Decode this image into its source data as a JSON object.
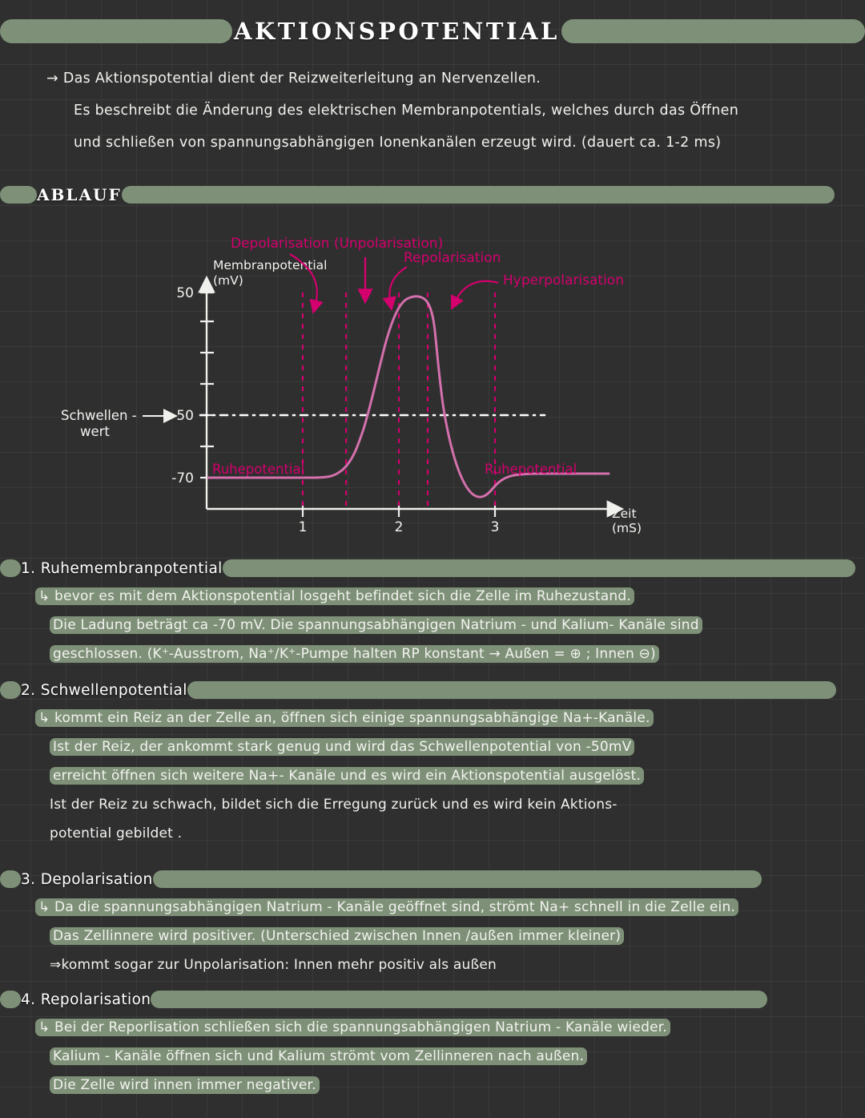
{
  "title": "AKTIONSPOTENTIAL",
  "intro": {
    "line1": "→ Das Aktionspotential dient der Reizweiterleitung an Nervenzellen.",
    "line2": "Es beschreibt die Änderung des elektrischen Membranpotentials, welches durch das Öffnen",
    "line3": "und schließen von spannungsabhängigen Ionenkanälen erzeugt wird. (dauert ca. 1-2 ms)"
  },
  "ablauf_heading": "ABLAUF",
  "chart_data": {
    "type": "line",
    "title": "",
    "xlabel": "Zeit (ms)",
    "ylabel": "Membranpotential (mV)",
    "y_axis_label_line1": "Membranpotential",
    "y_axis_label_line2": "(mV)",
    "x_axis_label_line1": "Zeit",
    "x_axis_label_line2": "(mS)",
    "xlim": [
      0,
      4
    ],
    "ylim": [
      -90,
      55
    ],
    "y_tick_labels": [
      "50",
      "-50",
      "-70"
    ],
    "y_tick_values": [
      50,
      -50,
      -70
    ],
    "y_minor_ticks": [
      30,
      10,
      -10,
      -60
    ],
    "x_tick_labels": [
      "1",
      "2",
      "3"
    ],
    "x_tick_values": [
      1,
      2,
      3
    ],
    "threshold_value": -50,
    "threshold_label_line1": "Schwellen -",
    "threshold_label_line2": "wert",
    "resting_value": -70,
    "resting_label": "Ruhepotential",
    "resting_label_2": "Ruhepotential",
    "peak_value": 45,
    "undershoot_value": -85,
    "annotations": [
      {
        "name": "depolarisation",
        "text": "Depolarisation (Unpolarisation)"
      },
      {
        "name": "repolarisation",
        "text": "Repolarisation"
      },
      {
        "name": "hyperpolarisation",
        "text": "Hyperpolarisation"
      }
    ],
    "dashed_marker_times": [
      1.0,
      1.45,
      2.0,
      2.3,
      3.0
    ],
    "series": [
      {
        "name": "Membranpotential",
        "x": [
          0.0,
          0.55,
          0.85,
          1.05,
          1.2,
          1.32,
          1.42,
          1.52,
          1.62,
          1.72,
          1.8,
          1.9,
          2.0,
          2.1,
          2.18,
          2.24,
          2.3,
          2.36,
          2.44,
          2.52,
          2.62,
          2.74,
          2.88,
          3.1,
          3.6
        ],
        "y": [
          -70,
          -70,
          -70,
          -68,
          -60,
          -46,
          -26,
          -4,
          16,
          32,
          40,
          45,
          46,
          44,
          36,
          18,
          -12,
          -46,
          -72,
          -84,
          -85,
          -80,
          -73,
          -71,
          -71
        ]
      }
    ],
    "grid": true,
    "legend": "none",
    "colors": {
      "curve": "#d470ad",
      "annotation": "#d4006e",
      "axis": "#f0f0ec"
    }
  },
  "sections": [
    {
      "heading": "1. Ruhemembranpotential",
      "lines": [
        "↳ bevor es mit dem Aktionspotential losgeht befindet sich die Zelle im Ruhezustand.",
        "Die Ladung beträgt ca -70 mV. Die spannungsabhängigen Natrium - und Kalium- Kanäle sind",
        "geschlossen. (K⁺-Ausstrom, Na⁺/K⁺-Pumpe halten RP konstant → Außen = ⊕ ; Innen ⊖)"
      ]
    },
    {
      "heading": "2. Schwellenpotential",
      "lines": [
        "↳ kommt ein Reiz an der Zelle an, öffnen sich einige spannungsabhängige Na+-Kanäle.",
        "Ist der Reiz, der ankommt stark genug und wird das Schwellenpotential von -50mV",
        "erreicht öffnen sich weitere Na+- Kanäle und es wird ein Aktionspotential ausgelöst.",
        "Ist der Reiz zu schwach, bildet sich die Erregung zurück und es wird kein Aktions-",
        "potential gebildet ."
      ]
    },
    {
      "heading": "3. Depolarisation",
      "lines": [
        "↳ Da die spannungsabhängigen Natrium - Kanäle geöffnet sind, strömt Na+ schnell in die Zelle ein.",
        "Das Zellinnere wird positiver. (Unterschied zwischen Innen /außen immer kleiner)",
        "⇒kommt sogar zur Unpolarisation: Innen mehr positiv als außen"
      ]
    },
    {
      "heading": "4. Repolarisation",
      "lines": [
        "↳ Bei der Reporlisation schließen sich die spannungsabhängigen Natrium - Kanäle wieder.",
        "Kalium - Kanäle öffnen sich und Kalium strömt vom Zellinneren nach außen.",
        "Die Zelle wird innen immer negativer."
      ]
    }
  ]
}
